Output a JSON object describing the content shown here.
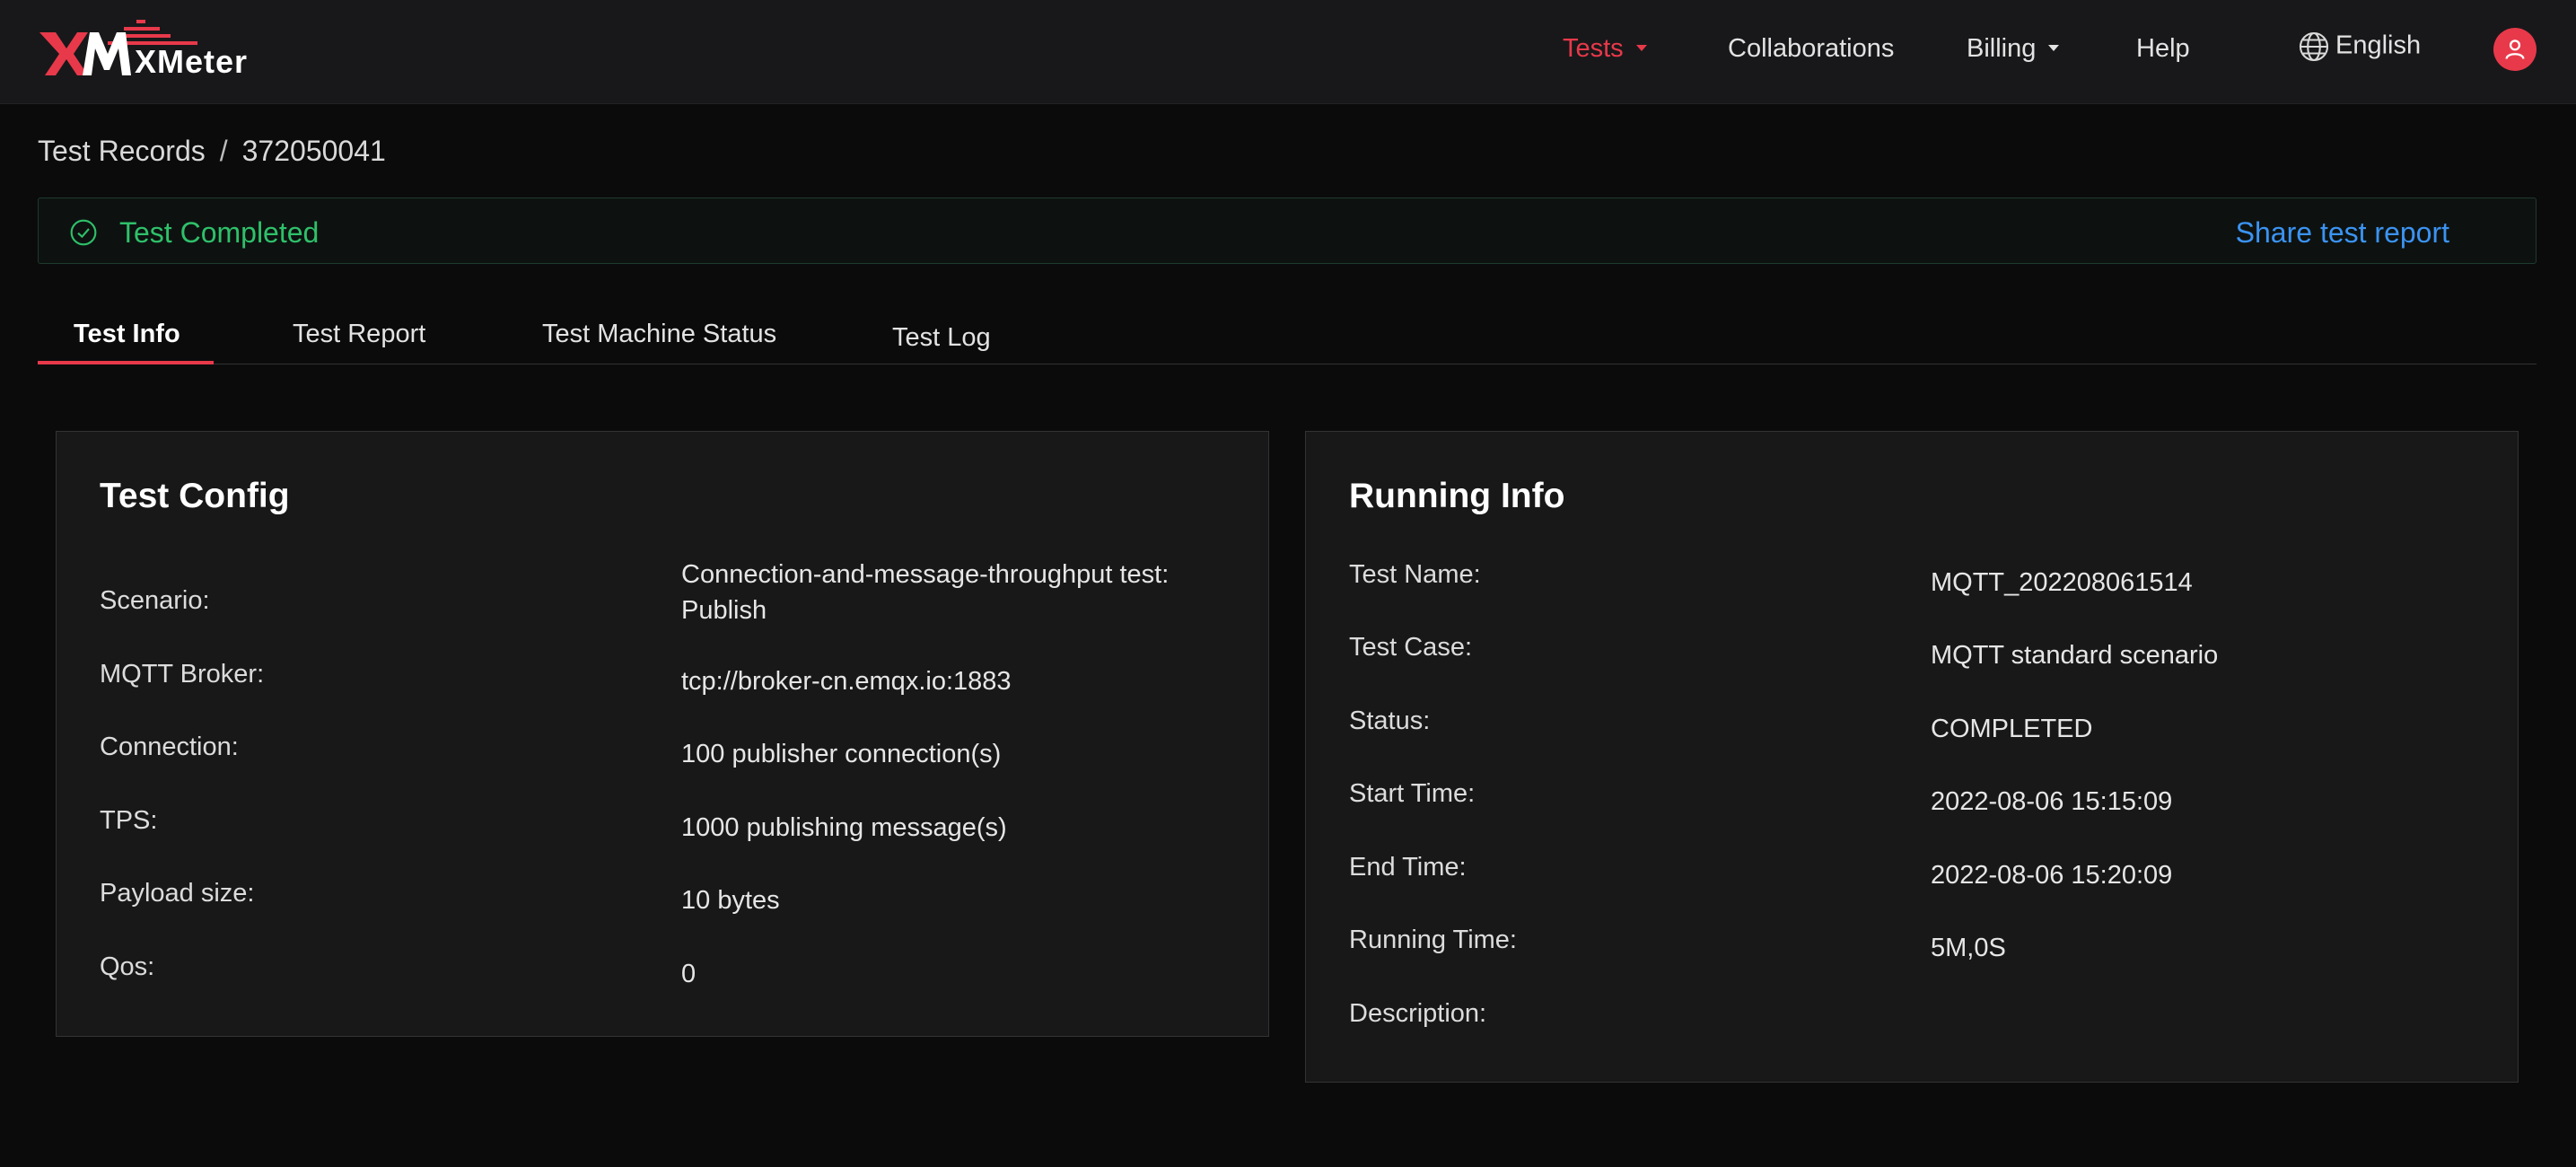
{
  "header": {
    "logo_text": "XMeter",
    "nav": [
      {
        "label": "Tests",
        "active": true,
        "has_dropdown": true
      },
      {
        "label": "Collaborations",
        "active": false,
        "has_dropdown": false
      },
      {
        "label": "Billing",
        "active": false,
        "has_dropdown": true
      },
      {
        "label": "Help",
        "active": false,
        "has_dropdown": false
      }
    ],
    "language": "English",
    "language_icon": "globe-icon",
    "avatar_icon": "user-icon"
  },
  "breadcrumb": {
    "parent": "Test Records",
    "separator": "/",
    "current": "372050041"
  },
  "status": {
    "icon": "check-circle-icon",
    "text": "Test Completed",
    "share_label": "Share test report"
  },
  "tabs": [
    {
      "label": "Test Info",
      "active": true
    },
    {
      "label": "Test Report",
      "active": false
    },
    {
      "label": "Test Machine Status",
      "active": false
    },
    {
      "label": "Test Log",
      "active": false
    }
  ],
  "test_config": {
    "title": "Test Config",
    "rows": [
      {
        "label": "Scenario:",
        "value": "Connection-and-message-throughput test: Publish"
      },
      {
        "label": "MQTT Broker:",
        "value": "tcp://broker-cn.emqx.io:1883"
      },
      {
        "label": "Connection:",
        "value": "100 publisher connection(s)"
      },
      {
        "label": "TPS:",
        "value": "1000 publishing message(s)"
      },
      {
        "label": "Payload size:",
        "value": "10 bytes"
      },
      {
        "label": "Qos:",
        "value": "0"
      }
    ]
  },
  "running_info": {
    "title": "Running Info",
    "rows": [
      {
        "label": "Test Name:",
        "value": "MQTT_202208061514"
      },
      {
        "label": "Test Case:",
        "value": "MQTT standard scenario"
      },
      {
        "label": "Status:",
        "value": "COMPLETED"
      },
      {
        "label": "Start Time:",
        "value": "2022-08-06 15:15:09"
      },
      {
        "label": "End Time:",
        "value": "2022-08-06 15:20:09"
      },
      {
        "label": "Running Time:",
        "value": "5M,0S"
      },
      {
        "label": "Description:",
        "value": ""
      }
    ]
  },
  "colors": {
    "accent": "#e8394a",
    "success": "#2fc06a",
    "link": "#3b93f2"
  }
}
